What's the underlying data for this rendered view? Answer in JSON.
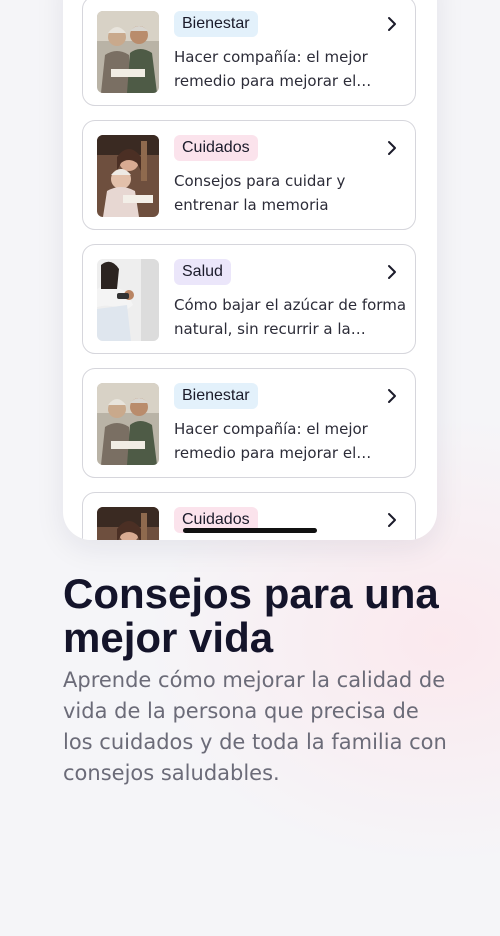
{
  "articles": [
    {
      "tag": "Bienestar",
      "tag_color": "#e3f1fb",
      "text": "Hacer compañía: el mejor remedio para mejorar el esta…",
      "thumb": "elderly-couple-photo"
    },
    {
      "tag": "Cuidados",
      "tag_color": "#fbe3ec",
      "text": "Consejos para cuidar y entrenar la memoria",
      "thumb": "grandmother-granddaughter-photo"
    },
    {
      "tag": "Salud",
      "tag_color": "#ebe6fa",
      "text": "Cómo bajar el azúcar de forma natural, sin recurrir a la insulina",
      "thumb": "glucose-test-photo"
    },
    {
      "tag": "Bienestar",
      "tag_color": "#e3f1fb",
      "text": "Hacer compañía: el mejor remedio para mejorar el esta…",
      "thumb": "elderly-couple-photo"
    },
    {
      "tag": "Cuidados",
      "tag_color": "#fbe3ec",
      "text": "",
      "thumb": "grandmother-granddaughter-photo"
    }
  ],
  "promo": {
    "title": "Consejos para una mejor vida",
    "description": "Aprende cómo mejorar la calidad de vida de la persona que precisa de los cuidados y de toda la familia con consejos saludables."
  }
}
